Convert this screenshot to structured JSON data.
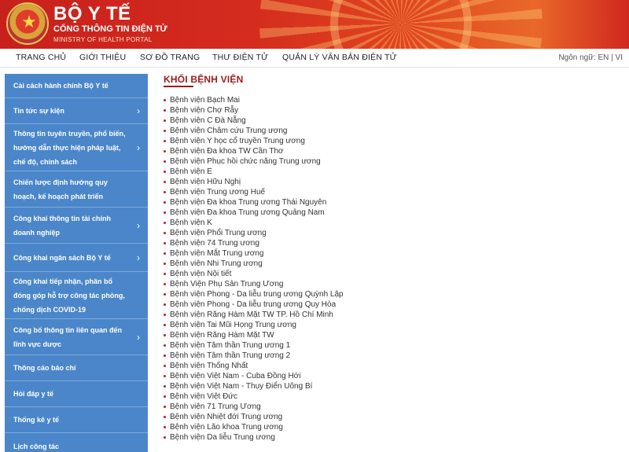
{
  "header": {
    "title": "BỘ Y TẾ",
    "subtitle": "CỔNG THÔNG TIN ĐIỆN TỬ",
    "tagline": "MINISTRY OF HEALTH PORTAL"
  },
  "nav": {
    "items": [
      "TRANG CHỦ",
      "GIỚI THIỆU",
      "SƠ ĐỒ TRANG",
      "THƯ ĐIỆN TỬ",
      "QUẢN LÝ VĂN BẢN ĐIỆN TỬ"
    ],
    "language": "Ngôn ngữ: EN | VI"
  },
  "sidebar": {
    "items": [
      {
        "label": "Cải cách hành chính Bộ Y tế",
        "has_submenu": false
      },
      {
        "label": "Tin tức sự kiện",
        "has_submenu": true
      },
      {
        "label": "Thông tin tuyên truyền, phổ biến, hướng dẫn thực hiện pháp luật, chế độ, chính sách",
        "has_submenu": true
      },
      {
        "label": "Chiến lược định hướng quy hoạch, kế hoạch phát triển",
        "has_submenu": false
      },
      {
        "label": "Công khai thông tin tài chính doanh nghiệp",
        "has_submenu": true
      },
      {
        "label": "Công khai ngân sách Bộ Y tế",
        "has_submenu": true
      },
      {
        "label": "Công khai tiếp nhận, phân bổ đóng góp hỗ trợ công tác phòng, chống dịch COVID-19",
        "has_submenu": false
      },
      {
        "label": "Công bố thông tin liên quan đến lĩnh vực dược",
        "has_submenu": true
      },
      {
        "label": "Thông cáo báo chí",
        "has_submenu": false
      },
      {
        "label": "Hỏi đáp y tế",
        "has_submenu": false
      },
      {
        "label": "Thống kê y tế",
        "has_submenu": false
      },
      {
        "label": "Lịch công tác",
        "has_submenu": false
      }
    ]
  },
  "content": {
    "title": "KHỐI BỆNH VIỆN",
    "hospitals": [
      "Bệnh viện Bạch Mai",
      "Bệnh viện Chợ Rẫy",
      "Bệnh viện C Đà Nẵng",
      "Bệnh viện Châm cứu Trung ương",
      "Bệnh viện Y học cổ truyền Trung ương",
      "Bệnh viện Đa khoa TW Cần Thơ",
      "Bệnh viện Phục hồi chức năng Trung ương",
      "Bệnh viện E",
      "Bệnh viện Hữu Nghị",
      "Bệnh viện Trung ương Huế",
      "Bệnh viện Đa khoa Trung ương Thái Nguyên",
      "Bệnh viện Đa khoa Trung ương Quảng Nam",
      "Bệnh viện K",
      "Bệnh viện Phổi Trung ương",
      "Bệnh viện 74 Trung ương",
      "Bệnh viện Mắt Trung ương",
      "Bệnh viện Nhi Trung ương",
      "Bệnh viện Nội tiết",
      "Bệnh Viện Phụ Sản Trung Ương",
      "Bệnh viện Phong - Da liễu trung ương Quỳnh Lập",
      "Bệnh viện Phong - Da liễu trung ương Quy Hòa",
      "Bệnh viện Răng Hàm Mặt TW TP. Hồ Chí Minh",
      "Bệnh viện Tai Mũi Họng Trung ương",
      "Bệnh viện Răng Hàm Mặt TW",
      "Bệnh viện Tâm thần Trung ương 1",
      "Bệnh viện Tâm thần Trung ương 2",
      "Bệnh viện Thống Nhất",
      "Bệnh viện Việt Nam - Cuba Đồng Hới",
      "Bệnh viện Việt Nam - Thụy Điển Uông Bí",
      "Bệnh viện Việt Đức",
      "Bệnh viện 71 Trung Ương",
      "Bệnh viện Nhiệt đới Trung ương",
      "Bệnh viện Lão khoa Trung ương",
      "Bệnh viện Da liễu Trung ương"
    ]
  },
  "icons": {
    "emblem": "national-emblem-icon",
    "submenu": "chevron-right-icon",
    "bullet": "bullet-icon"
  },
  "colors": {
    "brand_red": "#c8201c",
    "sidebar_blue": "#4a86c9",
    "title_red": "#9e1b1b"
  }
}
